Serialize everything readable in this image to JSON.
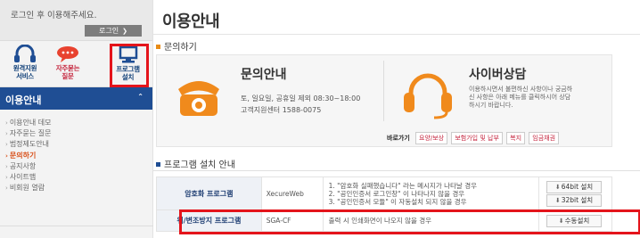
{
  "sidebar": {
    "login_message": "로그인 후 이용해주세요.",
    "login_button": "로그인",
    "quick_links": [
      {
        "label_line1": "원격지원",
        "label_line2": "서비스",
        "icon": "headset-icon"
      },
      {
        "label_line1": "자주묻는",
        "label_line2": "질문",
        "icon": "chat-bubble-icon"
      },
      {
        "label_line1": "프로그램",
        "label_line2": "설치",
        "icon": "monitor-icon"
      }
    ],
    "section_title": "이용안내",
    "menu": [
      "이용안내 데모",
      "자주묻는 질문",
      "범정제도안내",
      "문의하기",
      "공지사항",
      "사이트맵",
      "비회원 열람"
    ]
  },
  "main": {
    "page_title": "이용안내",
    "contact_section": "문의하기",
    "contact": {
      "title": "문의안내",
      "hours": "토, 일요일, 공휴일 제외 08:30~18:00",
      "center": "고객지원센터 1588-0075",
      "icon": "telephone-icon"
    },
    "cyber": {
      "title": "사이버상담",
      "line1": "이용하시면서 불편하신 사항이나 궁금하",
      "line2": "신 사항은 아래 메뉴를 클릭하시어 상담",
      "line3": "하시기 바랍니다.",
      "icon": "headset-icon"
    },
    "shortcuts": {
      "label": "바로가기",
      "items": [
        "요양/보상",
        "보험가입 및 납부",
        "복지",
        "임금채권"
      ]
    },
    "program_section": "프로그램 설치 안내",
    "programs": [
      {
        "name": "암호화 프로그램",
        "software": "XecureWeb",
        "desc": [
          "1. \"암호화 실패했습니다\" 라는 메시지가 나타날 경우",
          "2. \"공인인증서 로그인창\" 이 나타나지 않을 경우",
          "3. \"공인인증서 모듈\" 이 자동설치 되지 않을 경우"
        ],
        "buttons": [
          "64bit 설치",
          "32bit 설치"
        ]
      },
      {
        "name": "위/변조방지 프로그램",
        "software": "SGA-CF",
        "desc": [
          "출력 시 인쇄화면이 나오지 않을 경우"
        ],
        "buttons": [
          "수동설치"
        ]
      }
    ]
  },
  "colors": {
    "accent_red": "#e4141b",
    "nav_blue": "#1f4e94",
    "active_orange": "#d9531e"
  }
}
